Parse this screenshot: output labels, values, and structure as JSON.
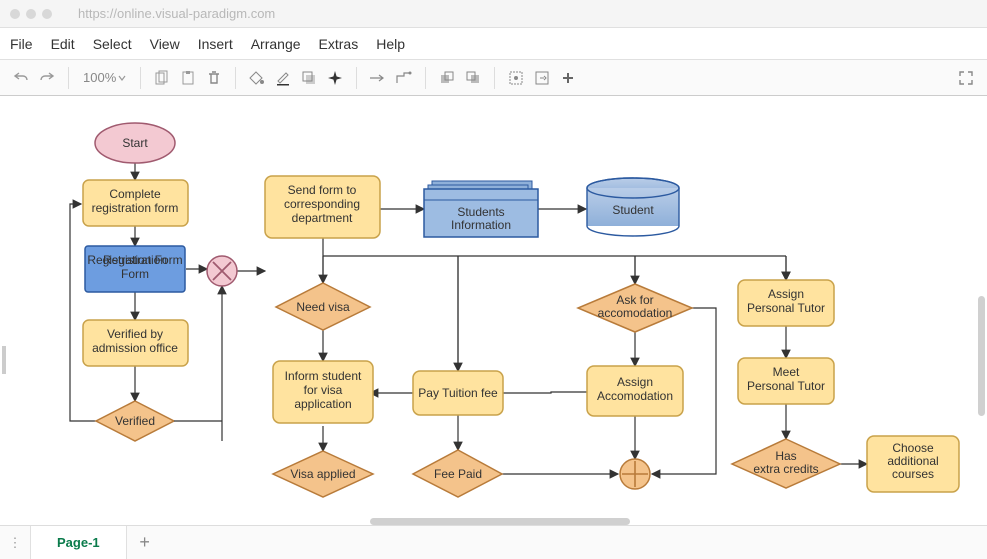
{
  "chrome": {
    "url": "https://online.visual-paradigm.com"
  },
  "menubar": {
    "items": [
      "File",
      "Edit",
      "Select",
      "View",
      "Insert",
      "Arrange",
      "Extras",
      "Help"
    ]
  },
  "toolbar": {
    "zoom": "100%"
  },
  "footer": {
    "page_tab": "Page-1"
  },
  "nodes": {
    "start": "Start",
    "complete_reg": "Complete registration form",
    "reg_form": "Registration Form",
    "verified_by": "Verified by admission office",
    "verified": "Verified",
    "send_form_l1": "Send form to",
    "send_form_l2": "corresponding",
    "send_form_l3": "department",
    "students_info_l1": "Students",
    "students_info_l2": "Information",
    "student": "Student",
    "need_visa": "Need visa",
    "inform_l1": "Inform student",
    "inform_l2": "for visa",
    "inform_l3": "application",
    "visa_applied": "Visa applied",
    "pay_tuition": "Pay Tuition fee",
    "fee_paid": "Fee Paid",
    "ask_acc_l1": "Ask for",
    "ask_acc_l2": "accomodation",
    "assign_acc_l1": "Assign",
    "assign_acc_l2": "Accomodation",
    "assign_tutor_l1": "Assign",
    "assign_tutor_l2": "Personal Tutor",
    "meet_tutor_l1": "Meet",
    "meet_tutor_l2": "Personal Tutor",
    "has_credits_l1": "Has",
    "has_credits_l2": "extra credits",
    "choose_l1": "Choose",
    "choose_l2": "additional",
    "choose_l3": "courses"
  }
}
